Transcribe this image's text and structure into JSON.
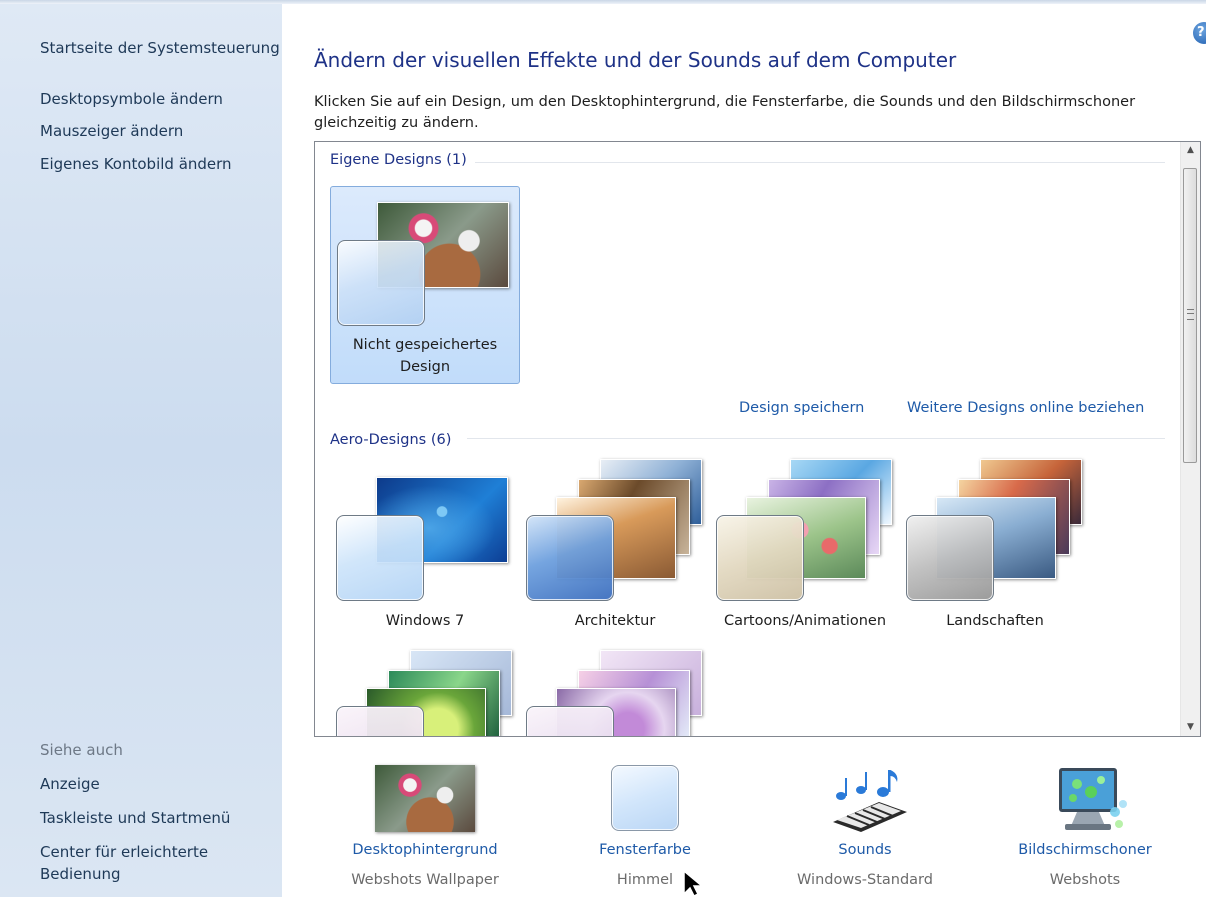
{
  "sidebar": {
    "home_link": "Startseite der Systemsteuerung",
    "links": [
      "Desktopsymbole ändern",
      "Mauszeiger ändern",
      "Eigenes Kontobild ändern"
    ],
    "see_also_label": "Siehe auch",
    "see_also": [
      "Anzeige",
      "Taskleiste und Startmenü",
      "Center für erleichterte",
      "Bedienung"
    ]
  },
  "main": {
    "title": "Ändern der visuellen Effekte und der Sounds auf dem Computer",
    "description_line1": "Klicken Sie auf ein Design, um den Desktophintergrund, die Fensterfarbe, die Sounds und den Bildschirmschoner",
    "description_line2": "gleichzeitig zu ändern."
  },
  "gallery": {
    "my_designs_header": "Eigene Designs (1)",
    "unsaved_design_line1": "Nicht gespeichertes",
    "unsaved_design_line2": "Design",
    "save_design_link": "Design speichern",
    "more_designs_link": "Weitere Designs online beziehen",
    "aero_header": "Aero-Designs (6)",
    "aero_designs": [
      "Windows 7",
      "Architektur",
      "Cartoons/Animationen",
      "Landschaften"
    ]
  },
  "bottom": {
    "background_label": "Desktophintergrund",
    "background_value": "Webshots Wallpaper",
    "color_label": "Fensterfarbe",
    "color_value": "Himmel",
    "sounds_label": "Sounds",
    "sounds_value": "Windows-Standard",
    "screensaver_label": "Bildschirmschoner",
    "screensaver_value": "Webshots"
  },
  "icons": {
    "help": "help-icon",
    "scroll_up": "scroll-up-arrow-icon",
    "scroll_down": "scroll-down-arrow-icon",
    "sounds": "music-notes-keyboard-icon",
    "screensaver": "monitor-bubbles-icon",
    "cursor": "mouse-pointer-icon"
  },
  "colors": {
    "link": "#1e5aa8",
    "title": "#1e3287",
    "sidebar_bg": "#d4e2f2",
    "selection": "#cfe3fb"
  }
}
